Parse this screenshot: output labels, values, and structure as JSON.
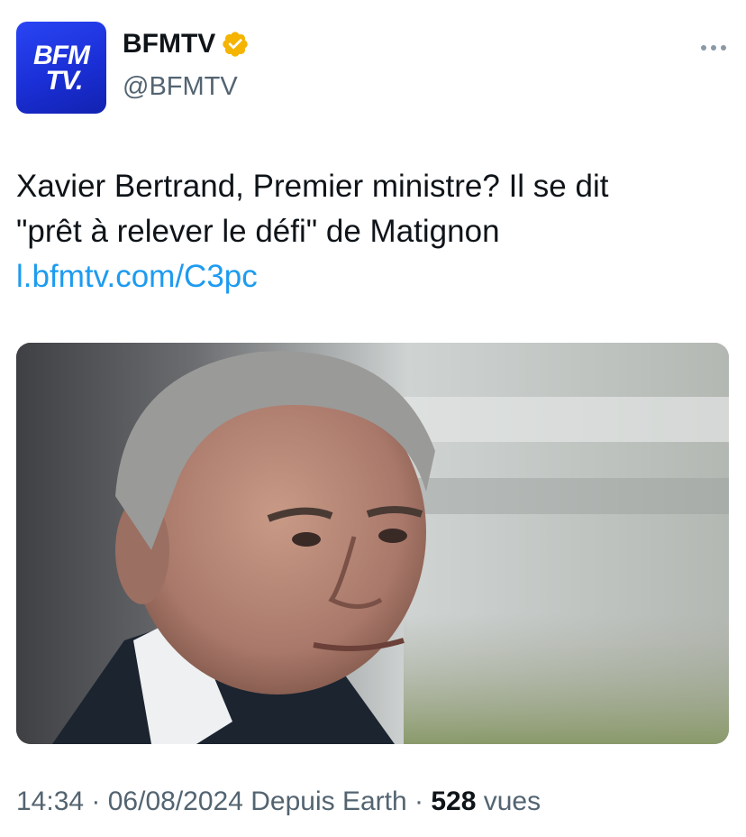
{
  "account": {
    "avatar_line1": "BFM",
    "avatar_line2": "TV.",
    "display_name": "BFMTV",
    "handle": "@BFMTV",
    "verified_badge_color": "#f4b400"
  },
  "tweet": {
    "text_line1": "Xavier Bertrand, Premier ministre? Il se dit",
    "text_line2": "\"prêt à relever le défi\" de Matignon",
    "link": "l.bfmtv.com/C3pc",
    "link_color": "#1d9bf0"
  },
  "meta": {
    "time": "14:34",
    "sep1": " · ",
    "date": "06/08/2024",
    "source": " Depuis Earth",
    "sep2": " · ",
    "views_count": "528",
    "views_label": " vues"
  },
  "icons": {
    "more": "more-dots-icon",
    "verified": "verified-badge-icon"
  }
}
